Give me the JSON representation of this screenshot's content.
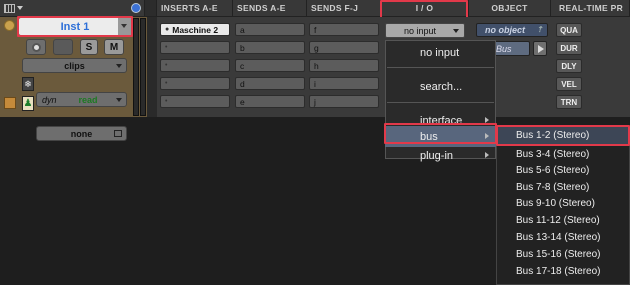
{
  "headers": {
    "inserts": "INSERTS A-E",
    "sends_ae": "SENDS A-E",
    "sends_fj": "SENDS F-J",
    "io": "I / O",
    "object": "OBJECT",
    "realtime": "REAL-TIME PR"
  },
  "track": {
    "name": "Inst 1",
    "solo": "S",
    "mute": "M",
    "clips": "clips",
    "dyn": "dyn",
    "read": "read",
    "none": "none"
  },
  "inserts": [
    "Maschine 2",
    "",
    "",
    "",
    "",
    ""
  ],
  "sends_ae": [
    "a",
    "b",
    "c",
    "d",
    "e"
  ],
  "sends_fj": [
    "f",
    "g",
    "h",
    "i",
    "j"
  ],
  "io": {
    "input": "no input",
    "bus": "Bus"
  },
  "object": {
    "label": "no object"
  },
  "realtime": [
    "QUA",
    "DUR",
    "DLY",
    "VEL",
    "TRN"
  ],
  "menu": {
    "no_input": "no input",
    "search": "search...",
    "interface": "interface",
    "bus": "bus",
    "plugin": "plug-in"
  },
  "bus_items": [
    "Bus 1-2 (Stereo)",
    "Bus 3-4 (Stereo)",
    "Bus 5-6 (Stereo)",
    "Bus 7-8 (Stereo)",
    "Bus 9-10 (Stereo)",
    "Bus 11-12 (Stereo)",
    "Bus 13-14 (Stereo)",
    "Bus 15-16 (Stereo)",
    "Bus 17-18 (Stereo)"
  ],
  "colors": {
    "highlight_box": "#e2394a",
    "track_name_text": "#2d6fd8",
    "menu_highlight": "#58667d"
  }
}
